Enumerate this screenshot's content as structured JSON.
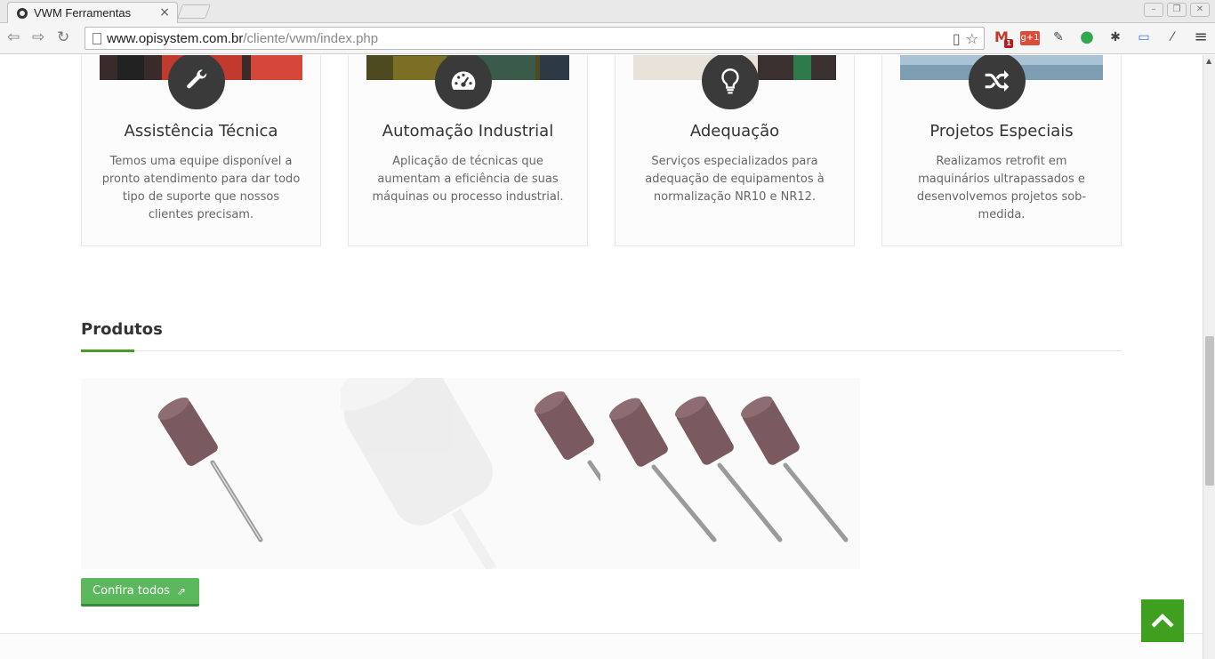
{
  "browser": {
    "tab_title": "VWM Ferramentas",
    "tab_close": "×",
    "url_host": "www.opisystem.com.br",
    "url_path": "/cliente/vwm/index.php",
    "window_buttons": [
      "–",
      "❐",
      "✕"
    ],
    "extensions": [
      "gmail-icon",
      "google-plus-icon",
      "pen-icon",
      "leaf-icon",
      "bug-icon",
      "cast-icon",
      "dropper-icon",
      "menu-icon"
    ],
    "gmail_badge": "1",
    "gplus_label": "g+1"
  },
  "services": [
    {
      "title": "Assistência Técnica",
      "description": "Temos uma equipe disponível a pronto atendimento para dar todo tipo de suporte que nossos clientes precisam.",
      "icon": "wrench-icon",
      "image_color": "#c23a2e"
    },
    {
      "title": "Automação Industrial",
      "description": "Aplicação de técnicas que aumentam a eficiência de suas máquinas ou processo industrial.",
      "icon": "dashboard-icon",
      "image_color": "#6b6a2a"
    },
    {
      "title": "Adequação",
      "description": "Serviços especializados para adequação de equipamentos à normalização NR10 e NR12.",
      "icon": "lightbulb-icon",
      "image_color": "#d8cfc4"
    },
    {
      "title": "Projetos Especiais",
      "description": "Realizamos retrofit em maquinários ultrapassados e desenvolvemos projetos sob-medida.",
      "icon": "shuffle-icon",
      "image_color": "#8fb0c6"
    }
  ],
  "products_section": {
    "title": "Produtos",
    "button_label": "Confira todos",
    "items": [
      {
        "name": "product-single-grinding-point",
        "stone_color": "#7a5a5f"
      },
      {
        "name": "product-grinding-point-zoom",
        "stone_color": "#7a5a5f"
      },
      {
        "name": "product-grinding-point-set",
        "stone_color": "#7a5a5f"
      }
    ]
  },
  "colors": {
    "accent_green": "#4b9a2a",
    "button_green": "#5cb85c",
    "icon_circle": "#3a3a3a",
    "back_to_top": "#3ea01e"
  }
}
